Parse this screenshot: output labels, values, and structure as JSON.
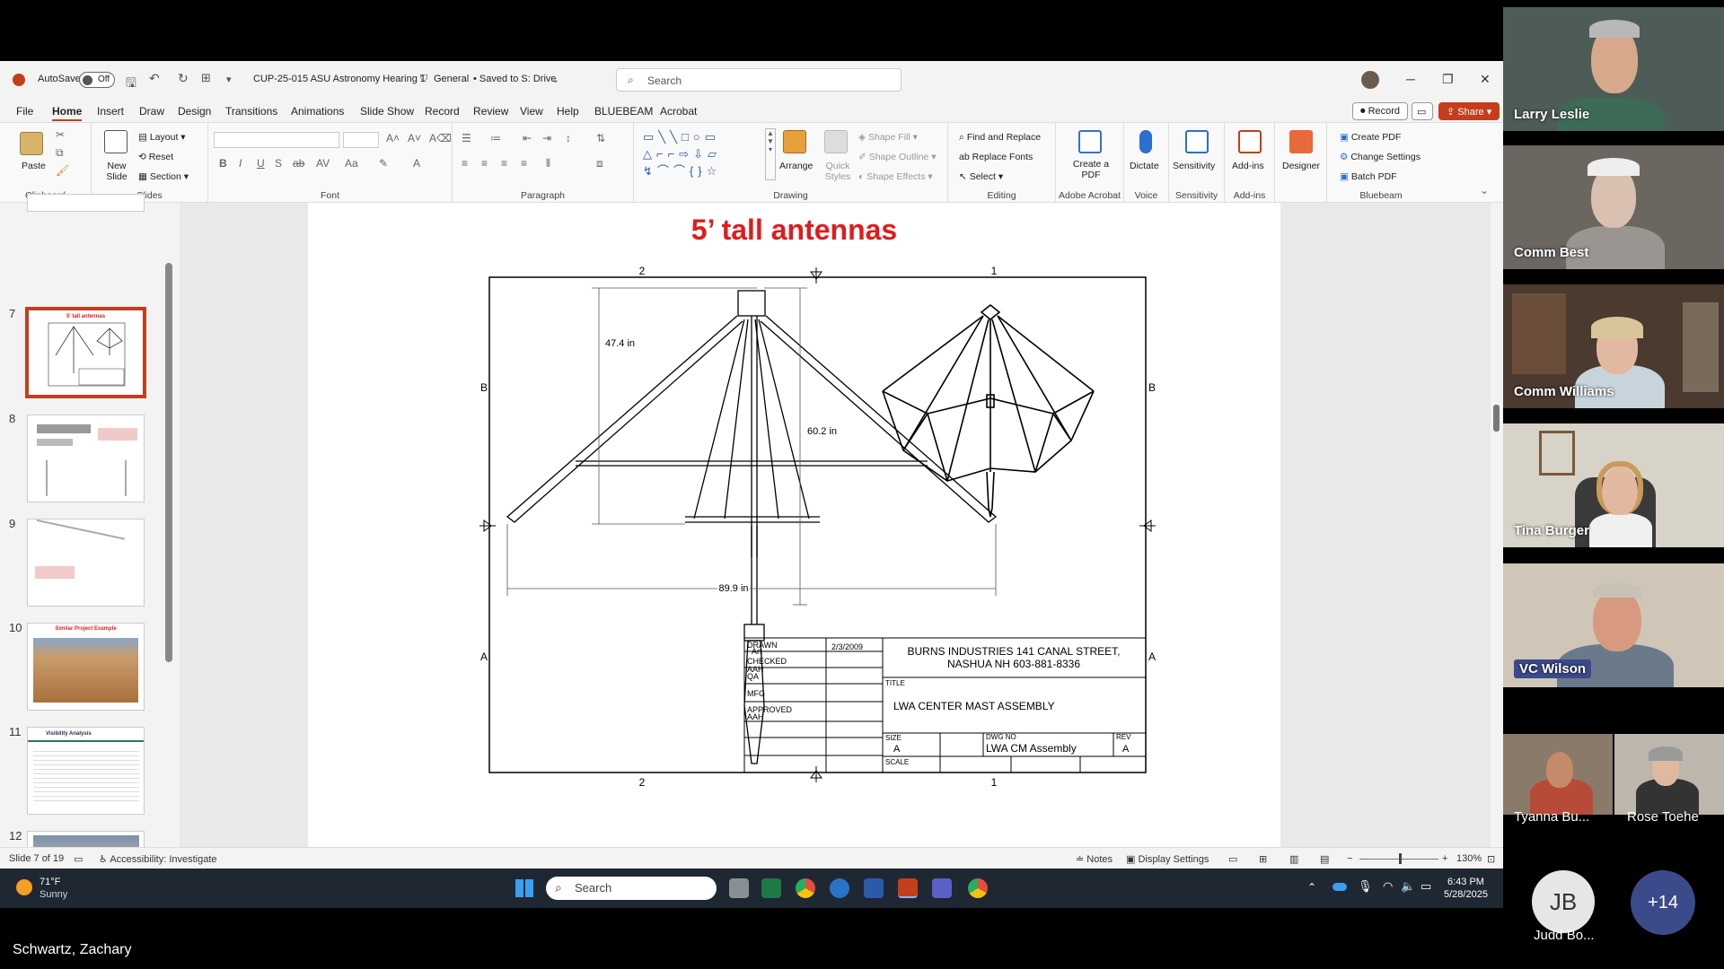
{
  "window": {
    "autosave_label": "AutoSave",
    "autosave_state": "Off",
    "file_title": "CUP-25-015 ASU Astronomy Hearing 1",
    "sensitivity": "General",
    "saved_status": "• Saved to S: Drive",
    "search_placeholder": "Search"
  },
  "menu": {
    "items": [
      "File",
      "Home",
      "Insert",
      "Draw",
      "Design",
      "Transitions",
      "Animations",
      "Slide Show",
      "Record",
      "Review",
      "View",
      "Help",
      "BLUEBEAM",
      "Acrobat"
    ],
    "record_btn": "Record",
    "share_btn": "Share"
  },
  "ribbon": {
    "clipboard": {
      "label": "Clipboard",
      "paste": "Paste"
    },
    "slides": {
      "label": "Slides",
      "new_slide": "New Slide",
      "layout": "Layout",
      "reset": "Reset",
      "section": "Section"
    },
    "font": {
      "label": "Font"
    },
    "paragraph": {
      "label": "Paragraph"
    },
    "drawing": {
      "label": "Drawing",
      "arrange": "Arrange",
      "quick_styles": "Quick Styles",
      "shape_fill": "Shape Fill",
      "shape_outline": "Shape Outline",
      "shape_effects": "Shape Effects"
    },
    "editing": {
      "label": "Editing",
      "find_replace": "Find and Replace",
      "replace_fonts": "Replace Fonts",
      "select": "Select"
    },
    "adobe": {
      "label": "Adobe Acrobat",
      "create_pdf": "Create a PDF"
    },
    "voice": {
      "label": "Voice",
      "dictate": "Dictate"
    },
    "sensitivity": {
      "label": "Sensitivity",
      "btn": "Sensitivity"
    },
    "addins": {
      "label": "Add-ins",
      "btn": "Add-ins"
    },
    "designer": {
      "btn": "Designer"
    },
    "bluebeam": {
      "label": "Bluebeam",
      "create_pdf": "Create PDF",
      "change_settings": "Change Settings",
      "batch_pdf": "Batch PDF"
    }
  },
  "thumbnails": [
    {
      "num": "7",
      "title": "5' tall antennas"
    },
    {
      "num": "8",
      "title": ""
    },
    {
      "num": "9",
      "title": ""
    },
    {
      "num": "10",
      "title": "Similar Project Example"
    },
    {
      "num": "11",
      "title": "Visibility Analysis"
    },
    {
      "num": "12",
      "title": ""
    }
  ],
  "slide": {
    "title": "5’ tall antennas",
    "dims": {
      "height": "47.4 in",
      "arm": "60.2 in",
      "width": "89.9 in"
    },
    "zones": {
      "top_left": "2",
      "top_right": "1",
      "left_b": "B",
      "right_b": "B",
      "left_a": "A",
      "right_a": "A",
      "bottom_left": "2",
      "bottom_right": "1"
    },
    "titleblock": {
      "drawn": "DRAWN",
      "drawn_by": "Art",
      "date": "2/3/2009",
      "checked": "CHECKED",
      "checked_by": "AAH",
      "qa": "QA",
      "mfg": "MFG",
      "approved": "APPROVED",
      "approved_by": "AAH",
      "company_line1": "BURNS INDUSTRIES 141 CANAL STREET,",
      "company_line2": "NASHUA NH 603-881-8336",
      "title_label": "TITLE",
      "title": "LWA CENTER MAST ASSEMBLY",
      "size_label": "SIZE",
      "size": "A",
      "dwg_label": "DWG NO",
      "dwg": "LWA CM Assembly",
      "rev_label": "REV",
      "rev": "A",
      "scale_label": "SCALE"
    }
  },
  "status": {
    "slide_info": "Slide 7 of 19",
    "accessibility": "Accessibility: Investigate",
    "notes": "Notes",
    "display_settings": "Display Settings",
    "zoom": "130%"
  },
  "taskbar": {
    "temp": "71°F",
    "weather": "Sunny",
    "search": "Search",
    "time": "6:43 PM",
    "date": "5/28/2025"
  },
  "participants": [
    {
      "name": "Larry Leslie"
    },
    {
      "name": "Comm Best"
    },
    {
      "name": "Comm Williams"
    },
    {
      "name": "Tina Burger"
    },
    {
      "name": "VC Wilson"
    },
    {
      "name": "Tyanna Bu..."
    },
    {
      "name": "Rose Toehe"
    },
    {
      "name": "Judd Bo...",
      "initials": "JB"
    }
  ],
  "more_participants": "+14",
  "presenter": "Schwartz, Zachary"
}
